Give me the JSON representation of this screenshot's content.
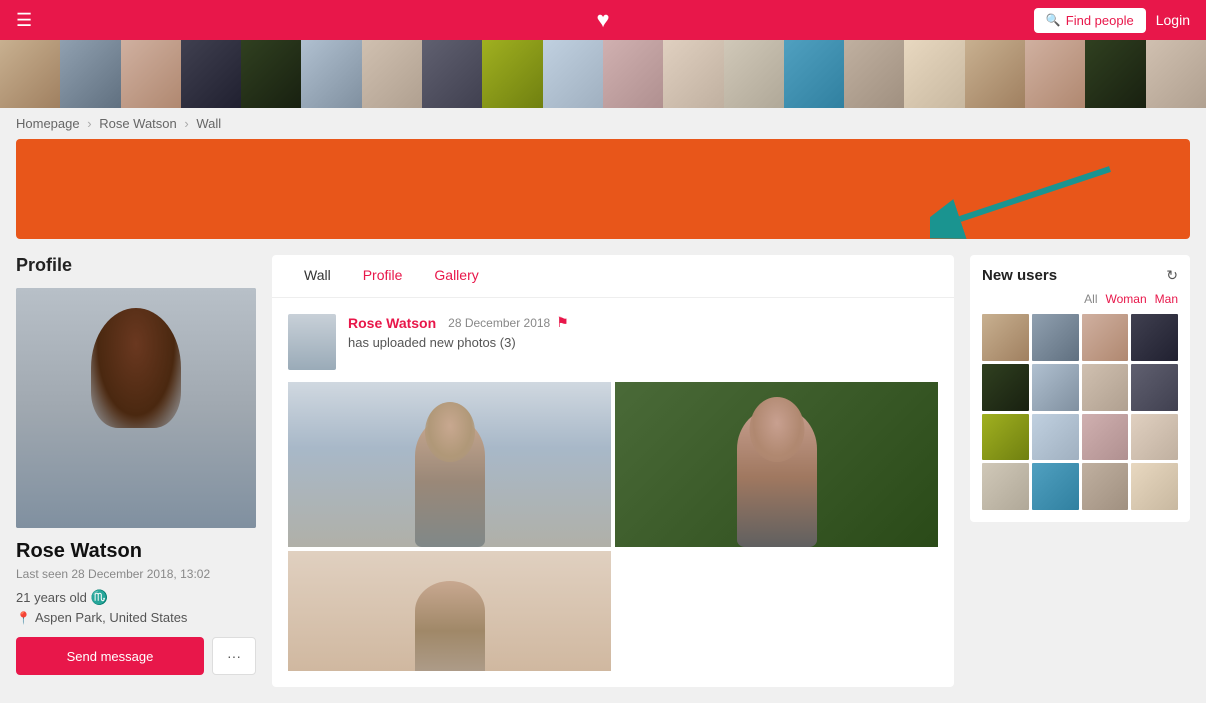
{
  "header": {
    "find_people_label": "Find people",
    "login_label": "Login"
  },
  "breadcrumb": {
    "homepage": "Homepage",
    "user": "Rose Watson",
    "current": "Wall"
  },
  "profile": {
    "name": "Rose Watson",
    "last_seen": "Last seen 28 December 2018, 13:02",
    "age": "21 years old",
    "sign": "♏",
    "location": "Aspen Park, United States",
    "send_message_label": "Send message",
    "more_label": "···"
  },
  "tabs": {
    "wall": "Wall",
    "profile": "Profile",
    "gallery": "Gallery"
  },
  "post": {
    "user": "Rose Watson",
    "date": "28 December 2018",
    "text": "has uploaded new photos (3)"
  },
  "new_users": {
    "title": "New users",
    "filters": {
      "all": "All",
      "woman": "Woman",
      "man": "Man"
    }
  }
}
